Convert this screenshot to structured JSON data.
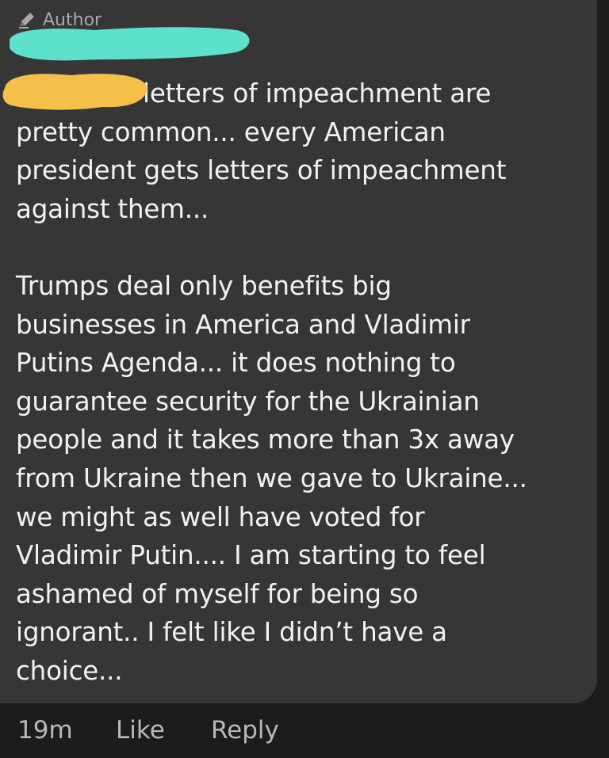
{
  "author_label": "Author",
  "colors": {
    "bubble": "#363636",
    "background": "#1c1c1c",
    "text": "#f2f2f2",
    "meta": "#b9b9b9",
    "redaction_name": "#5de0cc",
    "redaction_mention": "#f4c04a"
  },
  "comment": {
    "para1_lines": [
      "letters of impeachment are",
      "pretty common... every American",
      "president gets letters of impeachment",
      "against them..."
    ],
    "para2_lines": [
      "Trumps deal only benefits big",
      "businesses in America and Vladimir",
      "Putins Agenda... it does nothing to",
      "guarantee security for the Ukrainian",
      "people and it takes more than 3x away",
      "from Ukraine then we gave to Ukraine...",
      "we might as well have voted for",
      "Vladimir Putin.... I am starting to feel",
      "ashamed of myself for being so",
      "ignorant.. I felt like I didn’t have a",
      "choice..."
    ]
  },
  "actions": {
    "time": "19m",
    "like": "Like",
    "reply": "Reply"
  }
}
